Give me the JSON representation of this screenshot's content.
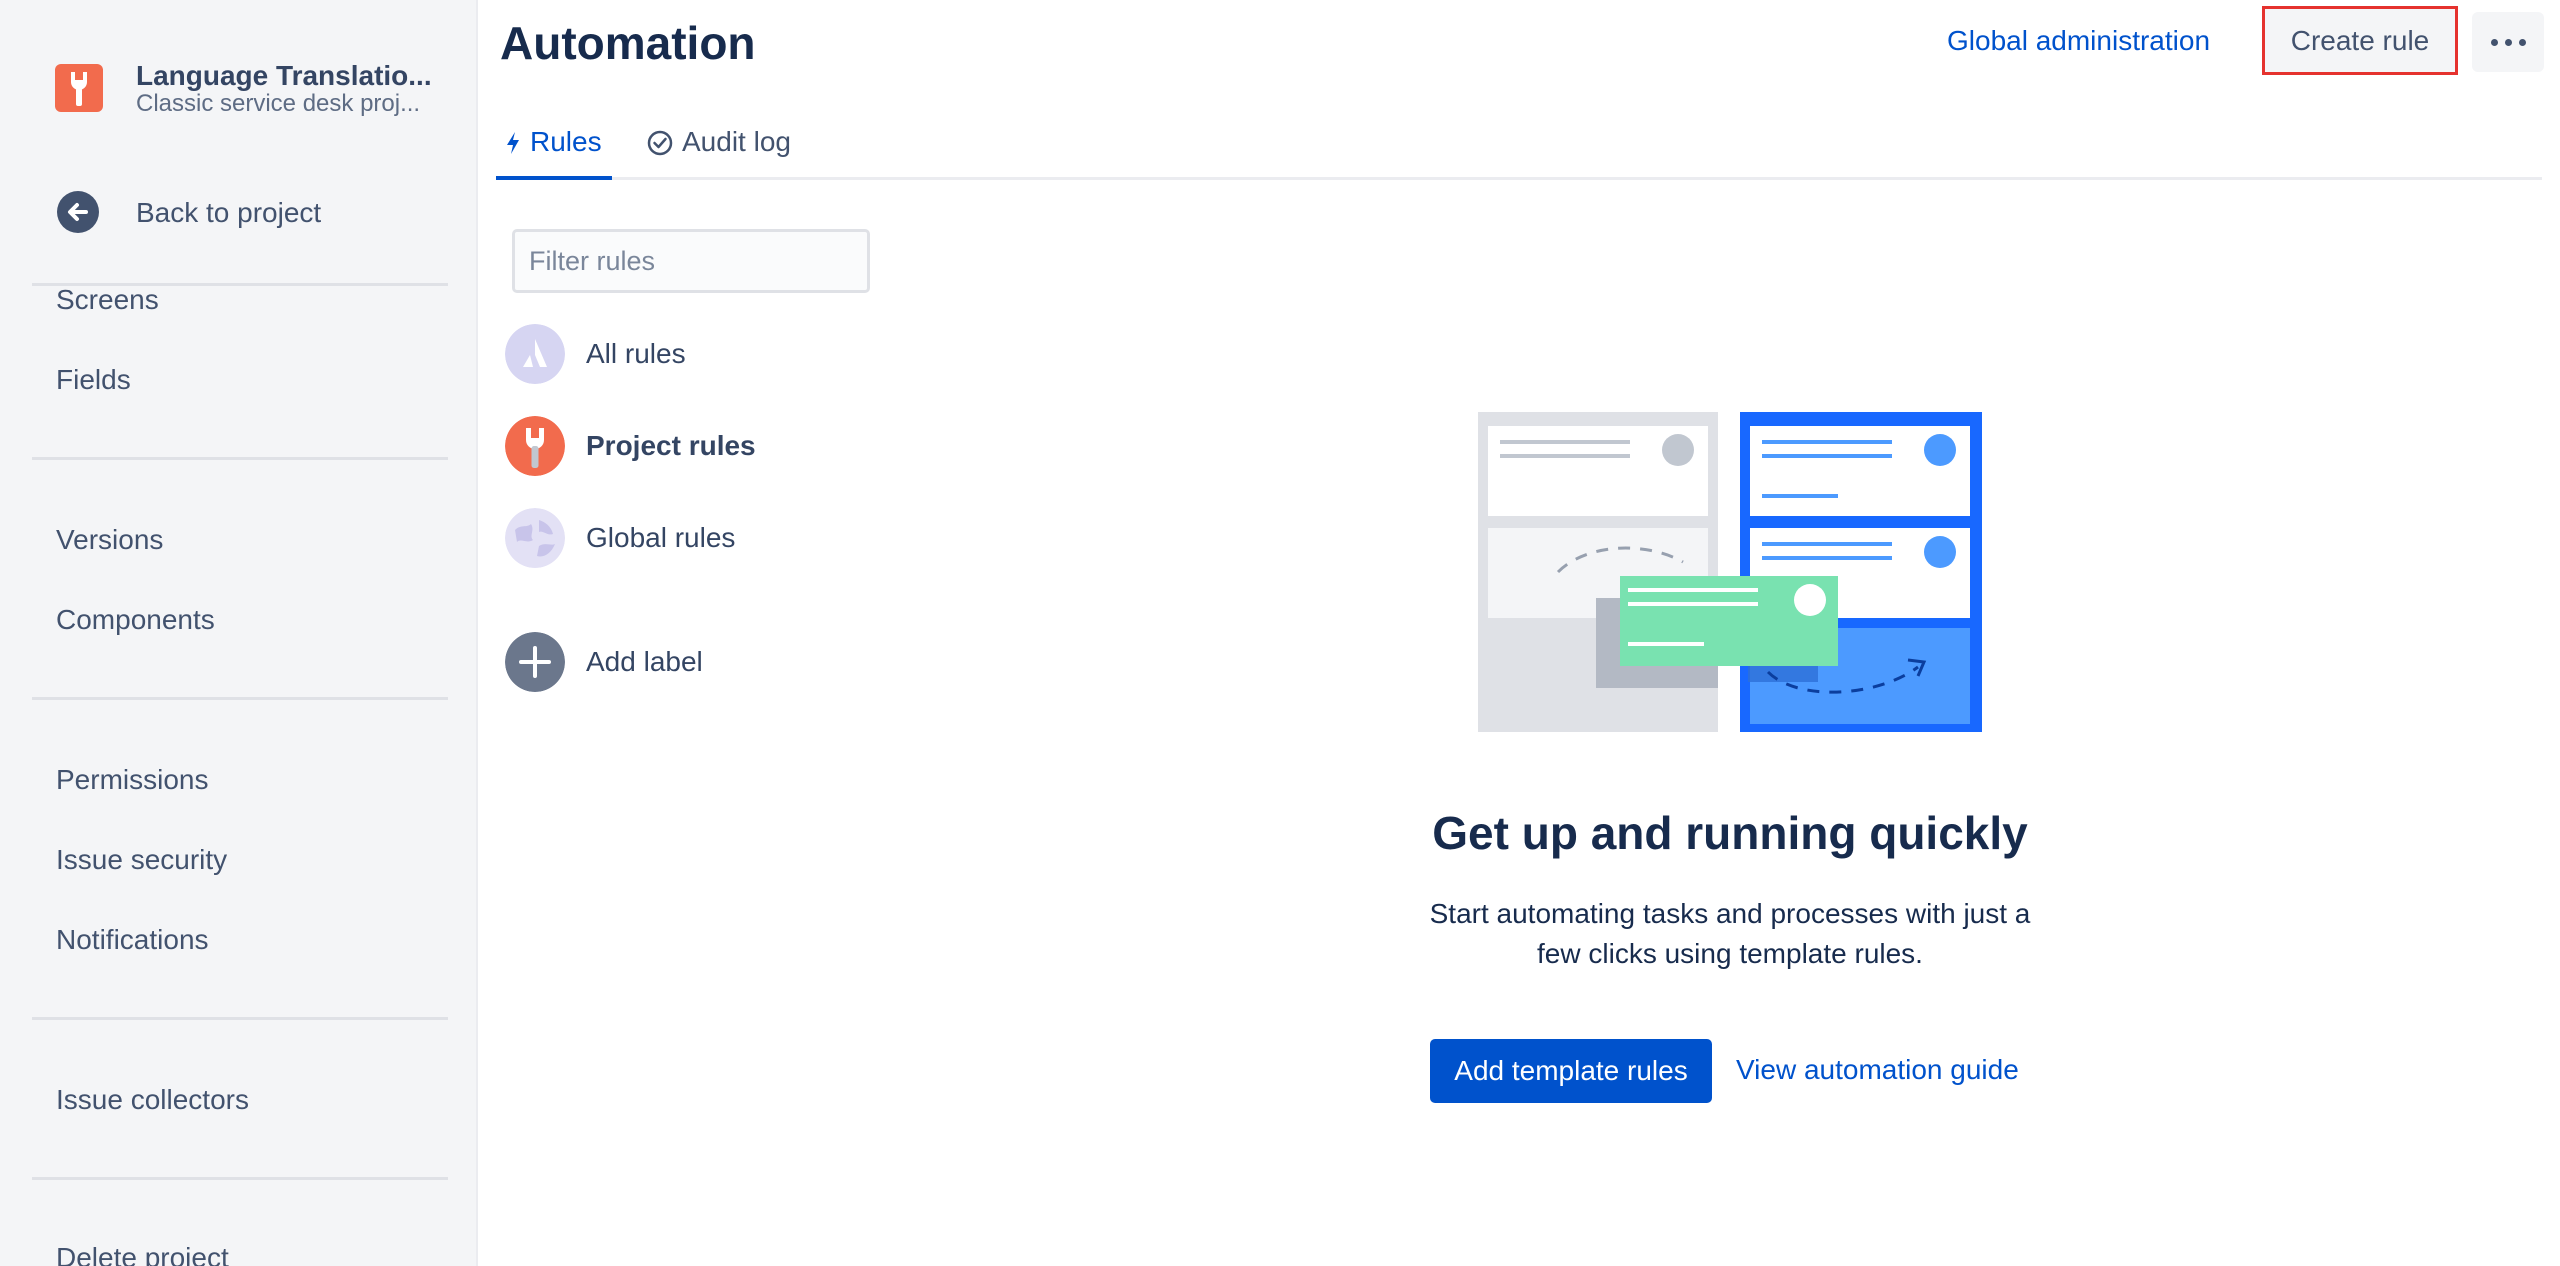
{
  "project": {
    "name": "Language Translatio...",
    "type": "Classic service desk proj..."
  },
  "sidebar": {
    "back_label": "Back to project",
    "items": [
      {
        "label": "Screens"
      },
      {
        "label": "Fields"
      },
      {
        "label": "Versions"
      },
      {
        "label": "Components"
      },
      {
        "label": "Permissions"
      },
      {
        "label": "Issue security"
      },
      {
        "label": "Notifications"
      },
      {
        "label": "Issue collectors"
      },
      {
        "label": "Delete project"
      }
    ]
  },
  "header": {
    "title": "Automation",
    "global_admin_label": "Global administration",
    "create_rule_label": "Create rule",
    "highlight_color": "#e5322e"
  },
  "tabs": [
    {
      "label": "Rules",
      "icon": "lightning-icon",
      "active": true
    },
    {
      "label": "Audit log",
      "icon": "check-circle-icon",
      "active": false
    }
  ],
  "filter": {
    "placeholder": "Filter rules",
    "value": ""
  },
  "rule_groups": [
    {
      "label": "All rules",
      "icon": "atlassian-logo-icon"
    },
    {
      "label": "Project rules",
      "icon": "project-wrench-icon"
    },
    {
      "label": "Global rules",
      "icon": "globe-icon"
    }
  ],
  "add_label": "Add label",
  "empty_state": {
    "title": "Get up and running quickly",
    "description": "Start automating tasks and processes with just a few clicks using template rules.",
    "primary_button": "Add template rules",
    "secondary_link": "View automation guide"
  },
  "colors": {
    "primary": "#0052cc",
    "project_avatar": "#f26b4d",
    "sidebar_bg": "#f4f5f7"
  }
}
